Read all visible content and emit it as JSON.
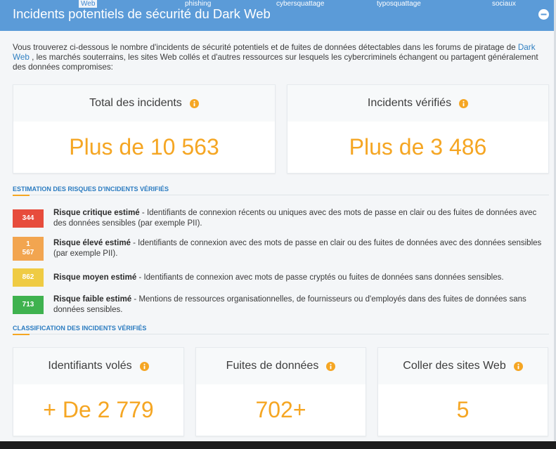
{
  "theme": {
    "header_bg": "#5b9bd8",
    "accent": "#f5a623",
    "section_title": "#2a7bc0",
    "link": "#2f7fc1"
  },
  "header": {
    "tabs": [
      {
        "label": "Web",
        "active": true
      },
      {
        "label": "phishing",
        "active": false
      },
      {
        "label": "cybersquattage",
        "active": false
      },
      {
        "label": "typosquattage",
        "active": false
      },
      {
        "label": "sociaux",
        "active": false
      }
    ],
    "title": "Incidents potentiels de sécurité du Dark Web",
    "collapse_icon": "minus-circle-icon"
  },
  "intro": {
    "text_before": "Vous trouverez ci-dessous le nombre d'incidents de sécurité potentiels et de fuites de données détectables dans les forums de piratage de ",
    "link": "Dark Web",
    "text_after": " , les marchés souterrains, les sites Web collés et d'autres ressources sur lesquels les cybercriminels échangent ou partagent généralement des données compromises:"
  },
  "summary_cards": [
    {
      "label": "Total des incidents",
      "value": "Plus de 10 563",
      "icon": "info-icon"
    },
    {
      "label": "Incidents vérifiés",
      "value": "Plus de 3 486",
      "icon": "info-icon"
    }
  ],
  "risk_section": {
    "title": "ESTIMATION DES RISQUES D'INCIDENTS VÉRIFIÉS",
    "items": [
      {
        "count": "344",
        "level": "Risque critique estimé",
        "description": "- Identifiants de connexion récents ou uniques avec des mots de passe en clair ou des fuites de données avec des données sensibles (par exemple PII).",
        "color": "#e74c3c"
      },
      {
        "count": "1 567",
        "level": "Risque élevé estimé",
        "description": "- Identifiants de connexion avec des mots de passe en clair ou des fuites de données avec des données sensibles (par exemple PII).",
        "color": "#f2a550"
      },
      {
        "count": "862",
        "level": "Risque moyen estimé",
        "description": "- Identifiants de connexion avec mots de passe cryptés ou fuites de données sans données sensibles.",
        "color": "#efcb43"
      },
      {
        "count": "713",
        "level": "Risque faible estimé",
        "description": "- Mentions de ressources organisationnelles, de fournisseurs ou d'employés dans des fuites de données sans données sensibles.",
        "color": "#3fb24f"
      }
    ]
  },
  "classification_section": {
    "title": "CLASSIFICATION DES INCIDENTS VÉRIFIÉS",
    "cards": [
      {
        "label": "Identifiants volés",
        "value": "+ De 2 779",
        "icon": "info-icon"
      },
      {
        "label": "Fuites de données",
        "value": "702+",
        "icon": "info-icon"
      },
      {
        "label": "Coller des sites Web",
        "value": "5",
        "icon": "info-icon"
      }
    ]
  }
}
